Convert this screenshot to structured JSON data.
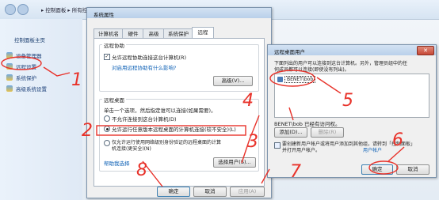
{
  "explorer": {
    "breadcrumb": "▸ 控制面板 ▸ 所有控制面板项 ▸ 系统",
    "sidebar": {
      "title": "控制面板主页",
      "items": [
        {
          "label": "设备管理器"
        },
        {
          "label": "远程设置"
        },
        {
          "label": "系统保护"
        },
        {
          "label": "高级系统设置"
        }
      ]
    }
  },
  "sysprops": {
    "title": "系统属性",
    "tabs": [
      "计算机名",
      "硬件",
      "高级",
      "系统保护",
      "远程"
    ],
    "assist": {
      "group_label": "远程协助",
      "checkbox_label": "允许远程协助连接这台计算机(R)",
      "link": "对启用远程协助有什么影响?",
      "advanced_button": "高级(V)..."
    },
    "desktop": {
      "group_label": "远程桌面",
      "instruction": "单击一个选项，然后指定谁可以连接(如果需要)。",
      "options": [
        "不允许连接到这台计算机(D)",
        "允许运行任意版本远程桌面的计算机连接(较不安全)(L)",
        "仅允许运行使用网络级别身份验证的远程桌面的计算",
        "机连接(更安全)(N)"
      ],
      "help_link": "帮助我选择",
      "select_users_button": "选择用户(S)..."
    },
    "buttons": {
      "ok": "确定",
      "cancel": "取消",
      "apply": "应用(A)"
    }
  },
  "rdusers": {
    "title": "远程桌面用户",
    "intro_lines": [
      "下面列出的用户可以连接到这台计算机。另外，管理员组中的任",
      "何成员都可以连接(即使没有列出)。"
    ],
    "listed_user": "BENET\\bob",
    "status": "BENET\\bob 已经有访问权。",
    "add_button": "添加(D)...",
    "remove_button": "删除(R)",
    "footer_lines": [
      "要创建新用户帐户或将用户添加到其他组，请转到「控制面板」",
      "并打开用户帐户。"
    ],
    "footer_link": "用户帐户",
    "buttons": {
      "ok": "确定",
      "cancel": "取消"
    }
  },
  "annotations": {
    "color": "#e8322a",
    "numbers": [
      "1",
      "2",
      "3",
      "4",
      "5",
      "6",
      "7",
      "8"
    ]
  }
}
